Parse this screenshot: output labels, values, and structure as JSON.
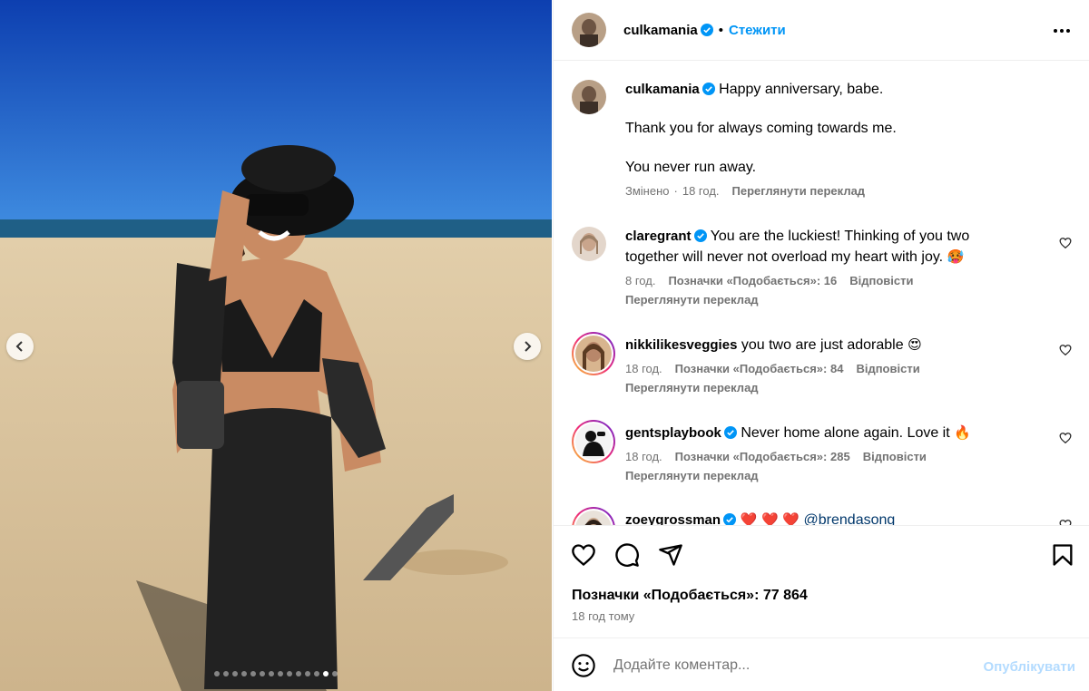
{
  "post": {
    "author": "culkamania",
    "follow_label": "Стежити",
    "separator": "•",
    "more_icon": "more-horizontal-icon"
  },
  "carousel": {
    "slide_count": 14,
    "active_slide": 12
  },
  "caption": {
    "username": "culkamania",
    "lines": [
      "Happy anniversary, babe.",
      "Thank you for always coming towards me.",
      "You never run away."
    ],
    "edited_label": "Змінено",
    "dot": "·",
    "time": "18 год.",
    "translate_label": "Переглянути переклад"
  },
  "comments": [
    {
      "username": "claregrant",
      "verified": true,
      "text": "You are the luckiest! Thinking of you two together will never not overload my heart with joy.",
      "emoji": "🥵",
      "time": "8 год.",
      "likes": "Позначки «Подобається»: 16",
      "reply": "Відповісти",
      "translate": "Переглянути переклад"
    },
    {
      "username": "nikkilikesveggies",
      "verified": false,
      "text": "you two are just adorable",
      "emoji": "😍",
      "time": "18 год.",
      "likes": "Позначки «Подобається»: 84",
      "reply": "Відповісти",
      "translate": "Переглянути переклад"
    },
    {
      "username": "gentsplaybook",
      "verified": true,
      "text": "Never home alone again. Love it",
      "emoji": "🔥",
      "time": "18 год.",
      "likes": "Позначки «Подобається»: 285",
      "reply": "Відповісти",
      "translate": "Переглянути переклад"
    },
    {
      "username": "zoeygrossman",
      "verified": true,
      "text": "",
      "emoji": "❤️ ❤️ ❤️",
      "mention": "@brendasong"
    }
  ],
  "stats": {
    "likes": "Позначки «Подобається»: 77 864",
    "posted": "18 год тому"
  },
  "composer": {
    "placeholder": "Додайте коментар...",
    "publish_label": "Опублікувати"
  },
  "colors": {
    "accent": "#0095f6",
    "muted": "#737373",
    "publish_disabled": "#b3dbff"
  }
}
